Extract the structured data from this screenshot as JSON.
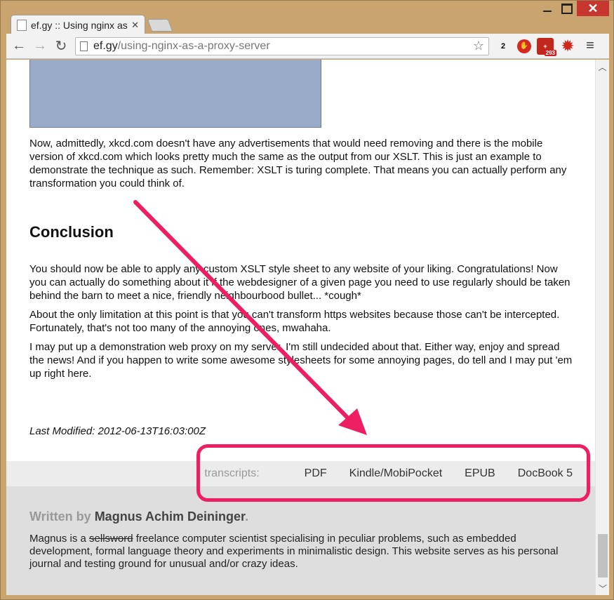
{
  "browser": {
    "tab_title": "ef.gy :: Using nginx as",
    "url_domain": "ef.gy",
    "url_path": "/using-nginx-as-a-proxy-server",
    "extension_badge": "293",
    "extension_counter": "2"
  },
  "article": {
    "paragraph_1": "Now, admittedly, xkcd.com doesn't have any advertisements that would need removing and there is the mobile version of xkcd.com which looks pretty much the same as the output from our XSLT. This is just an example to demonstrate the technique as such. Remember: XSLT is turing complete. That means you can actually perform any transformation you could think of.",
    "heading": "Conclusion",
    "paragraph_2": "You should now be able to apply any custom XSLT style sheet to any website of your liking. Congratulations! Now you can actually do something about it if the webdesigner of a given page you need to use regularly should be taken behind the barn to meet a nice, friendly neighbourbood bullet... *cough*",
    "paragraph_3": "About the only limitation at this point is that you can't transform https websites because those can't be intercepted. Fortunately, that's not too many of the annoying ones, mwahaha.",
    "paragraph_4": "I may put up a demonstration web proxy on my server, I'm still undecided about that. Either way, enjoy and spread the news! And if you happen to write some awesome stylesheets for some annoying pages, do tell and I may put 'em up right here.",
    "last_modified": "Last Modified: 2012-06-13T16:03:00Z"
  },
  "transcripts": {
    "label": "transcripts:",
    "links": [
      "PDF",
      "Kindle/MobiPocket",
      "EPUB",
      "DocBook 5"
    ]
  },
  "author": {
    "written_by": "Written by",
    "name": "Magnus Achim Deininger",
    "period": ".",
    "bio_start": "Magnus is a",
    "bio_strike": "sellsword",
    "bio_rest": "freelance computer scientist specialising in peculiar problems, such as embedded development, formal language theory and experiments in minimalistic design. This website serves as his personal journal and testing ground for unusual and/or crazy ideas."
  },
  "colors": {
    "annotation": "#ee1e63",
    "window_frame": "#c9a46f",
    "close_button": "#c7372f"
  }
}
